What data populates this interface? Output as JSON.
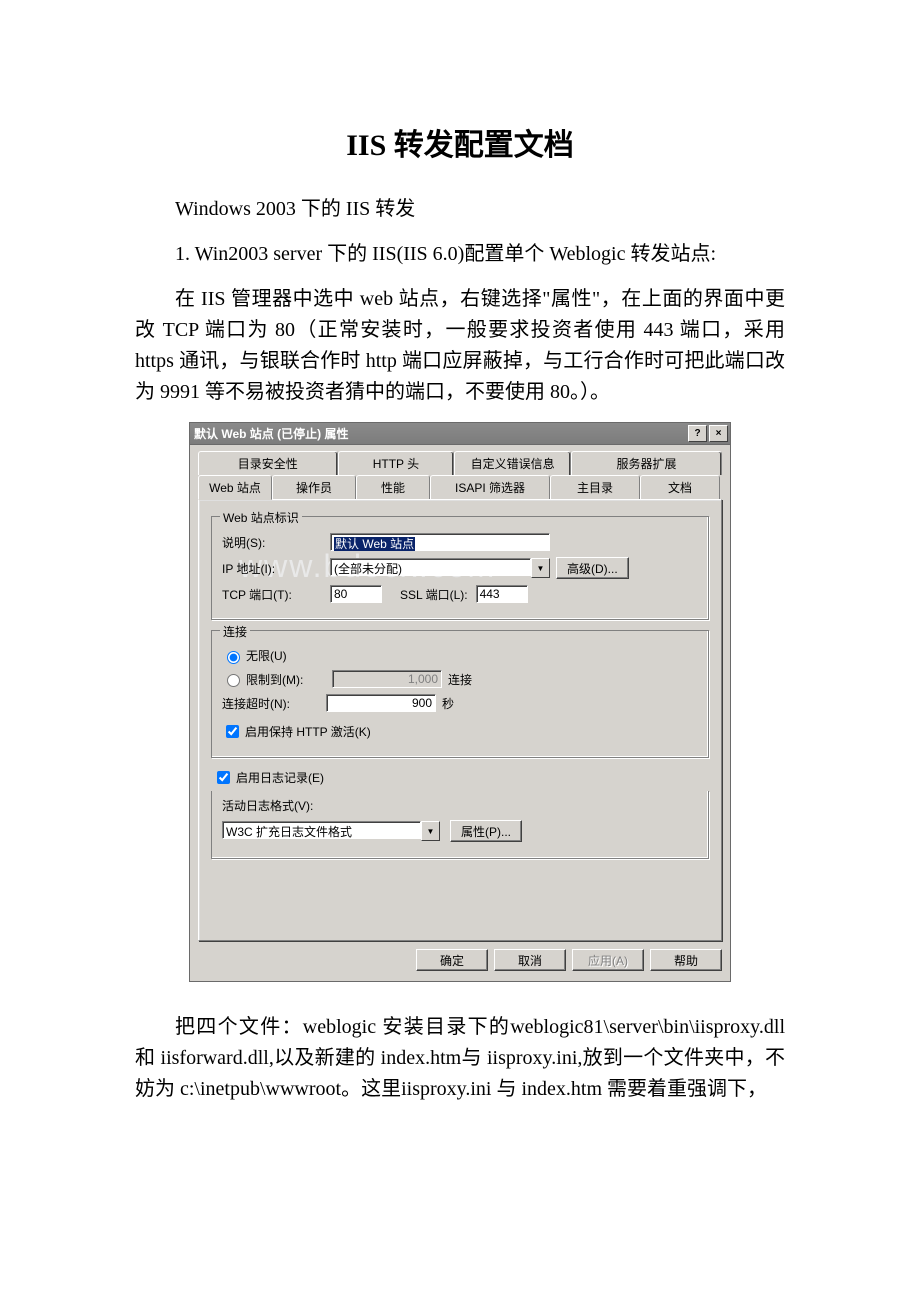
{
  "doc": {
    "title": "IIS 转发配置文档",
    "p1": "Windows 2003 下的 IIS 转发",
    "p2": "1. Win2003 server 下的 IIS(IIS 6.0)配置单个 Weblogic 转发站点:",
    "p3": "在 IIS 管理器中选中 web 站点，右键选择\"属性\"，在上面的界面中更改 TCP 端口为 80（正常安装时，一般要求投资者使用 443 端口，采用 https 通讯，与银联合作时 http 端口应屏蔽掉，与工行合作时可把此端口改为 9991 等不易被投资者猜中的端口，不要使用 80。）。",
    "p4": "把四个文件：weblogic 安装目录下的weblogic81\\server\\bin\\iisproxy.dll 和 iisforward.dll,以及新建的 index.htm与 iisproxy.ini,放到一个文件夹中，不妨为 c:\\inetpub\\wwwroot。这里iisproxy.ini 与 index.htm 需要着重强调下，"
  },
  "dlg": {
    "title": "默认 Web 站点 (已停止) 属性",
    "tabs_top": [
      "目录安全性",
      "HTTP 头",
      "自定义错误信息",
      "服务器扩展"
    ],
    "tabs_bot": [
      "Web 站点",
      "操作员",
      "性能",
      "ISAPI 筛选器",
      "主目录",
      "文档"
    ],
    "grp1": "Web 站点标识",
    "lbl_desc": "说明(S):",
    "val_desc": "默认 Web 站点",
    "lbl_ip": "IP 地址(I):",
    "val_ip": "(全部未分配)",
    "btn_adv": "高级(D)...",
    "lbl_tcp": "TCP 端口(T):",
    "val_tcp": "80",
    "lbl_ssl": "SSL 端口(L):",
    "val_ssl": "443",
    "grp2": "连接",
    "r_unl": "无限(U)",
    "r_lim": "限制到(M):",
    "val_lim": "1,000",
    "u_conn": "连接",
    "lbl_to": "连接超时(N):",
    "val_to": "900",
    "u_sec": "秒",
    "chk_keep": "启用保持 HTTP 激活(K)",
    "chk_log": "启用日志记录(E)",
    "lbl_fmt": "活动日志格式(V):",
    "val_fmt": "W3C 扩充日志文件格式",
    "btn_prop": "属性(P)...",
    "btn_ok": "确定",
    "btn_cancel": "取消",
    "btn_apply": "应用(A)",
    "btn_help": "帮助"
  }
}
